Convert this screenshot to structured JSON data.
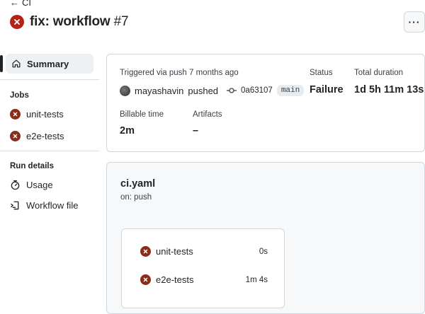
{
  "header": {
    "back_label": "CI",
    "title": "fix: workflow",
    "run_number": "#7",
    "more_label": "···"
  },
  "sidebar": {
    "summary_label": "Summary",
    "jobs_heading": "Jobs",
    "jobs": [
      {
        "label": "unit-tests",
        "status": "failure"
      },
      {
        "label": "e2e-tests",
        "status": "failure"
      }
    ],
    "run_details_heading": "Run details",
    "run_details": [
      {
        "label": "Usage",
        "icon": "stopwatch-icon"
      },
      {
        "label": "Workflow file",
        "icon": "workflow-file-icon"
      }
    ]
  },
  "summary": {
    "trigger_text": "Triggered via push 7 months ago",
    "actor": "mayashavin",
    "action": "pushed",
    "commit_sha": "0a63107",
    "branch": "main",
    "status_label": "Status",
    "status_value": "Failure",
    "duration_label": "Total duration",
    "duration_value": "1d 5h 11m 13s",
    "billable_label": "Billable time",
    "billable_value": "2m",
    "artifacts_label": "Artifacts",
    "artifacts_value": "–"
  },
  "graph": {
    "file_name": "ci.yaml",
    "trigger": "on: push",
    "jobs": [
      {
        "name": "unit-tests",
        "duration": "0s",
        "status": "failure"
      },
      {
        "name": "e2e-tests",
        "duration": "1m 4s",
        "status": "failure"
      }
    ]
  },
  "colors": {
    "failure": "#b42318",
    "failure_small": "#8a2c1b",
    "border": "#d0d7de",
    "graph_bg": "#f6f8fa"
  }
}
